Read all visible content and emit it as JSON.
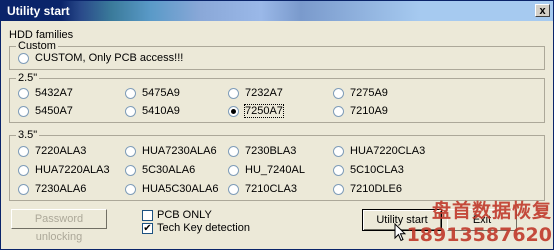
{
  "window": {
    "title": "Utility start",
    "close_glyph": "x"
  },
  "hdd_families_label": "HDD families",
  "custom_group": {
    "caption": "Custom",
    "option": {
      "label": "CUSTOM, Only PCB access!!!",
      "selected": false
    }
  },
  "group_25": {
    "caption": "2.5\"",
    "rows": [
      [
        {
          "label": "5432A7",
          "selected": false
        },
        {
          "label": "5475A9",
          "selected": false
        },
        {
          "label": "7232A7",
          "selected": false
        },
        {
          "label": "7275A9",
          "selected": false
        }
      ],
      [
        {
          "label": "5450A7",
          "selected": false
        },
        {
          "label": "5410A9",
          "selected": false
        },
        {
          "label": "7250A7",
          "selected": true
        },
        {
          "label": "7210A9",
          "selected": false
        }
      ]
    ]
  },
  "group_35": {
    "caption": "3.5\"",
    "rows": [
      [
        {
          "label": "7220ALA3",
          "selected": false
        },
        {
          "label": "HUA7230ALA6",
          "selected": false
        },
        {
          "label": "7230BLA3",
          "selected": false
        },
        {
          "label": "HUA7220CLA3",
          "selected": false
        }
      ],
      [
        {
          "label": "HUA7220ALA3",
          "selected": false
        },
        {
          "label": "5C30ALA6",
          "selected": false
        },
        {
          "label": "HU_7240AL",
          "selected": false
        },
        {
          "label": "5C10CLA3",
          "selected": false
        }
      ],
      [
        {
          "label": "7230ALA6",
          "selected": false
        },
        {
          "label": "HUA5C30ALA6",
          "selected": false
        },
        {
          "label": "7210CLA3",
          "selected": false
        },
        {
          "label": "7210DLE6",
          "selected": false
        }
      ]
    ]
  },
  "buttons": {
    "password_unlocking": "Password unlocking",
    "utility_start": "Utility start",
    "exit": "Exit"
  },
  "checkboxes": {
    "pcb_only": {
      "label": "PCB ONLY",
      "checked": false
    },
    "tech_key": {
      "label": "Tech Key detection",
      "checked": true,
      "mark": "✔"
    }
  },
  "watermark": {
    "text": "盘首数据恢复",
    "phone": "18913587620"
  },
  "icons": {
    "cursor": "arrow-cursor-icon"
  }
}
